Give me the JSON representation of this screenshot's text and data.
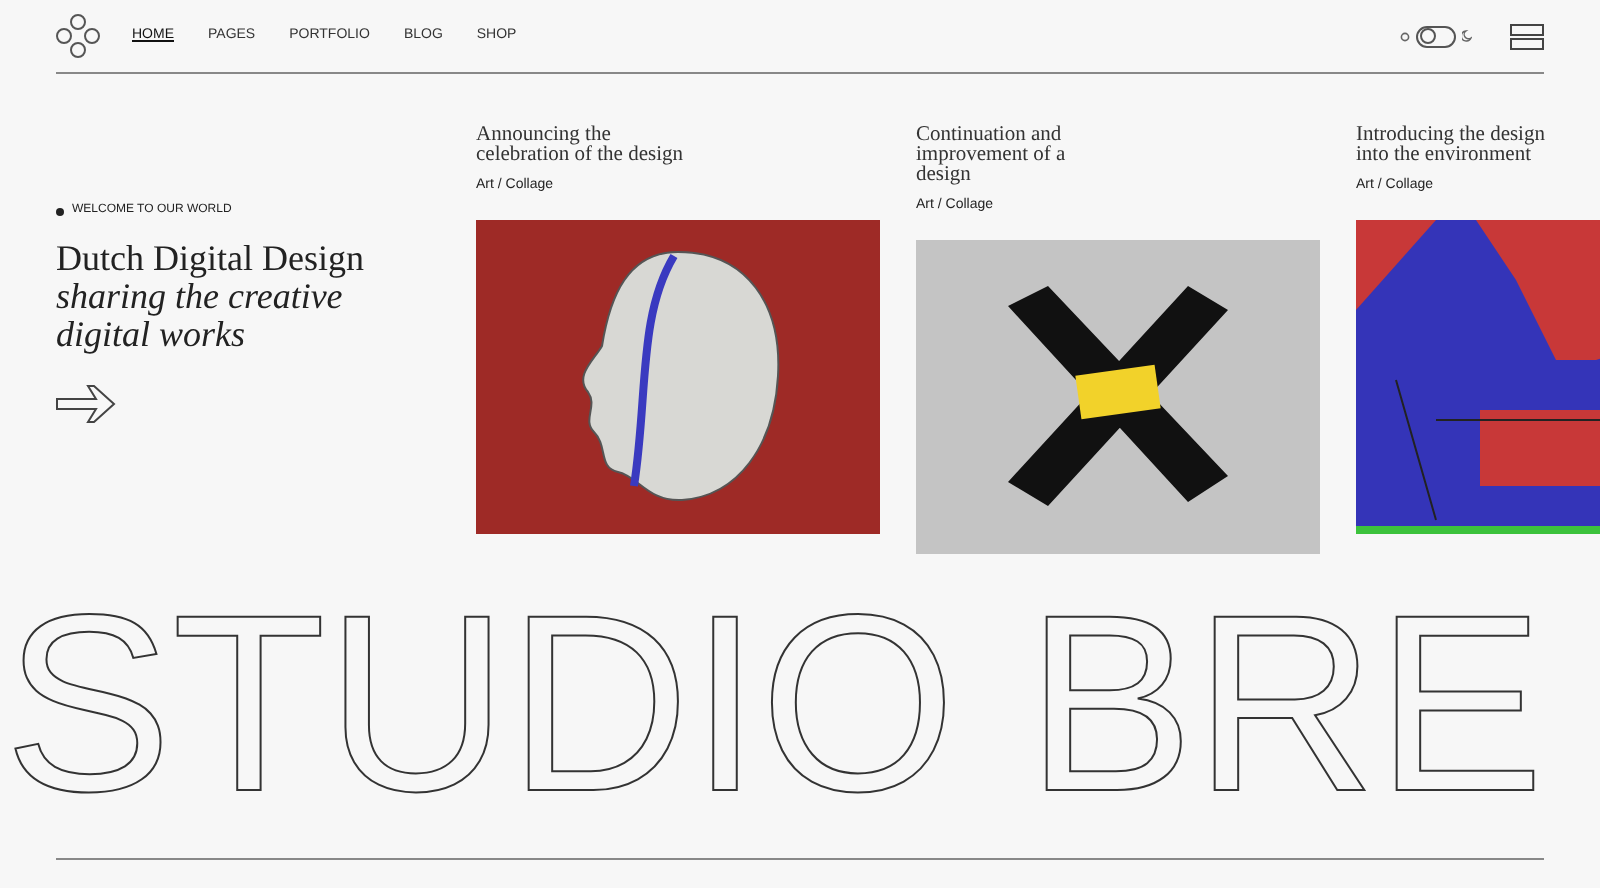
{
  "nav": {
    "items": [
      {
        "label": "HOME",
        "selected": true
      },
      {
        "label": "PAGES",
        "selected": false
      },
      {
        "label": "PORTFOLIO",
        "selected": false
      },
      {
        "label": "BLOG",
        "selected": false
      },
      {
        "label": "SHOP",
        "selected": false
      }
    ]
  },
  "theme_toggle": {
    "on": false
  },
  "hero": {
    "eyebrow": "WELCOME TO OUR WORLD",
    "title": "Dutch Digital Design",
    "subtitle": "sharing the creative digital works"
  },
  "cards": [
    {
      "kind": "face",
      "title": "Announcing the celebration of the design",
      "category": "Art / Collage"
    },
    {
      "kind": "cross",
      "title": "Continuation and improvement of a design",
      "category": "Art / Collage"
    },
    {
      "kind": "abstract",
      "title": "Introducing the design into the environment",
      "category": "Art / Collage"
    }
  ],
  "banner": {
    "text": "STUDIO BRE"
  }
}
